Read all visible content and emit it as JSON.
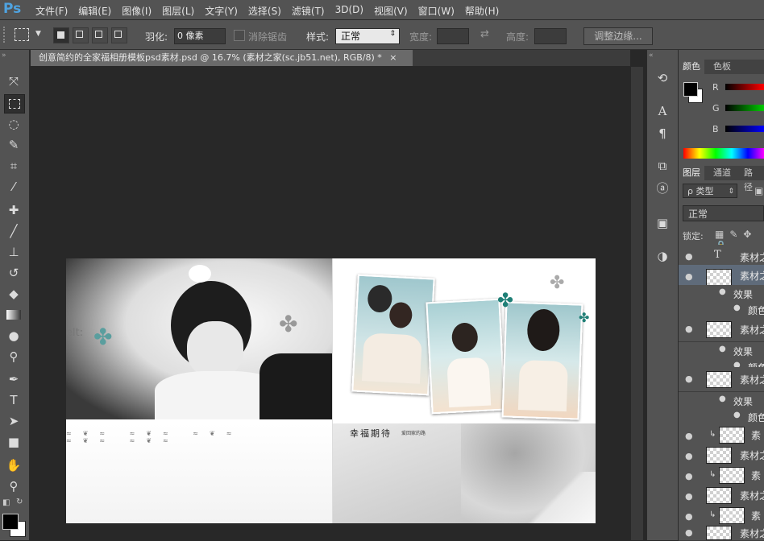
{
  "app": {
    "logo": "Ps"
  },
  "menu": [
    "文件(F)",
    "编辑(E)",
    "图像(I)",
    "图层(L)",
    "文字(Y)",
    "选择(S)",
    "滤镜(T)",
    "3D(D)",
    "视图(V)",
    "窗口(W)",
    "帮助(H)"
  ],
  "options": {
    "feather_label": "羽化:",
    "feather_value": "0 像素",
    "antialias_label": "消除锯齿",
    "style_label": "样式:",
    "style_value": "正常",
    "width_label": "宽度:",
    "height_label": "高度:",
    "refine_edge": "调整边缘..."
  },
  "document": {
    "tab_title": "创意简约的全家福相册模板psd素材.psd @ 16.7% (素材之家(sc.jb51.net), RGB/8) *",
    "close": "×"
  },
  "canvas": {
    "left_text": "elt:",
    "heading": "幸福期待",
    "heading_small": "爱回家的路"
  },
  "color_panel": {
    "tabs": [
      "颜色",
      "色板"
    ],
    "channels": [
      "R",
      "G",
      "B"
    ]
  },
  "layers_panel": {
    "tabs": [
      "图层",
      "通道",
      "路径"
    ],
    "filter_label": "ρ 类型",
    "blend_mode": "正常",
    "lock_label": "锁定:",
    "layers": [
      {
        "name": "素材之",
        "type": "text"
      },
      {
        "name": "素材之",
        "type": "image"
      },
      {
        "name": "效果",
        "type": "effect"
      },
      {
        "name": "颜色",
        "type": "effect-item"
      },
      {
        "name": "素材之",
        "type": "image"
      },
      {
        "name": "效果",
        "type": "effect"
      },
      {
        "name": "颜色",
        "type": "effect-item"
      },
      {
        "name": "素材之",
        "type": "image"
      },
      {
        "name": "效果",
        "type": "effect"
      },
      {
        "name": "颜色",
        "type": "effect-item"
      },
      {
        "name": "素",
        "type": "clip"
      },
      {
        "name": "素材之",
        "type": "image"
      },
      {
        "name": "素",
        "type": "clip"
      },
      {
        "name": "素材之",
        "type": "image"
      },
      {
        "name": "素",
        "type": "clip"
      },
      {
        "name": "素材之",
        "type": "image"
      }
    ]
  }
}
